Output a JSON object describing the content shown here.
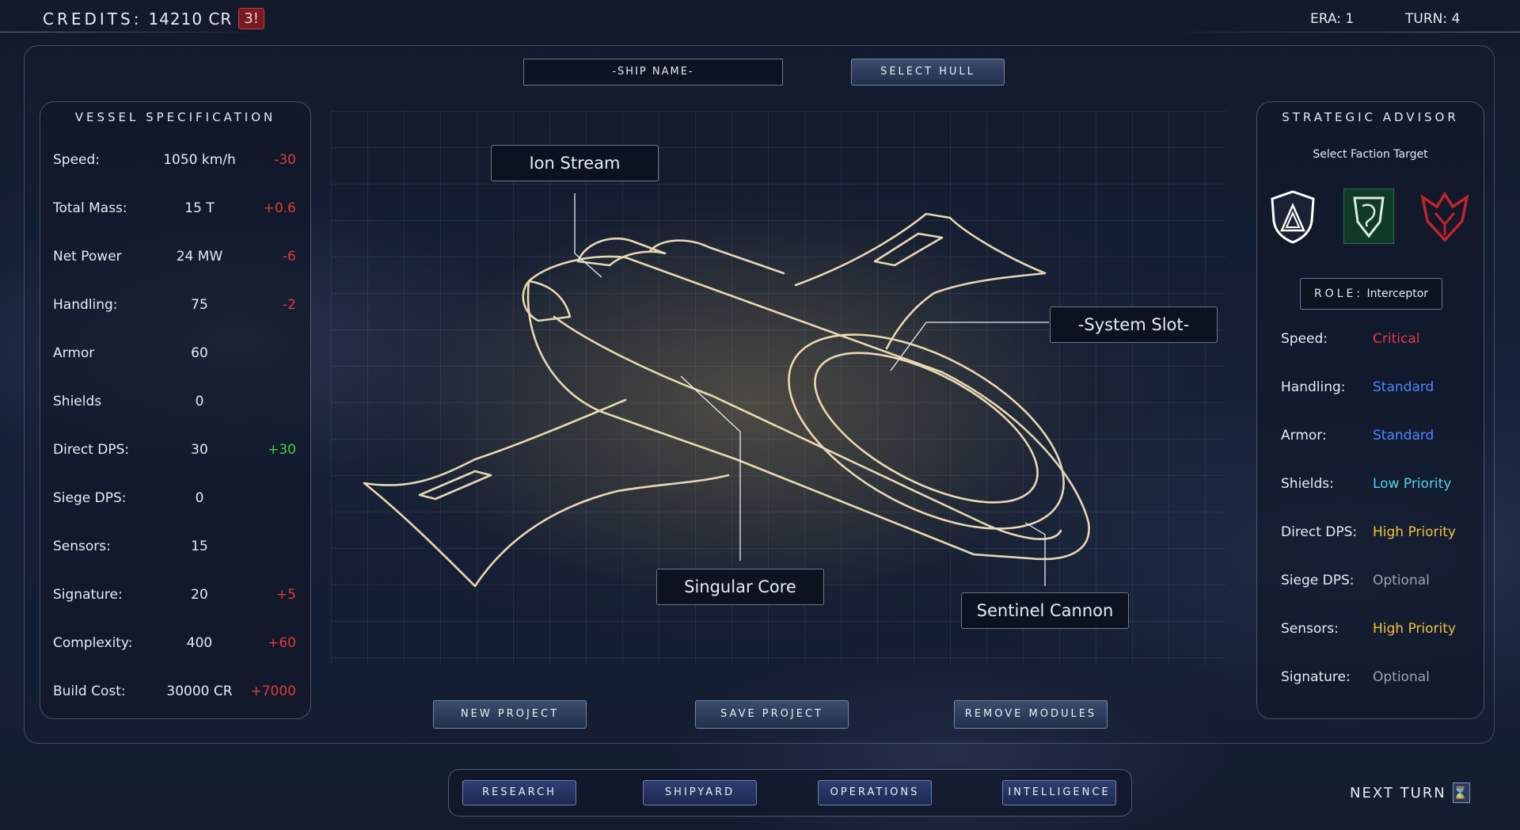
{
  "topbar": {
    "credits_label": "CREDITS:",
    "credits_value": "14210 CR",
    "credits_badge": "3!",
    "era": "ERA: 1",
    "turn": "TURN: 4"
  },
  "designer": {
    "ship_name_placeholder": "-SHIP NAME-",
    "select_hull": "SELECT HULL",
    "callouts": {
      "ion_stream": "Ion Stream",
      "system_slot": "-System Slot-",
      "singular_core": "Singular Core",
      "sentinel_cannon": "Sentinel Cannon"
    },
    "new_project": "NEW PROJECT",
    "save_project": "SAVE PROJECT",
    "remove_modules": "REMOVE MODULES"
  },
  "spec": {
    "title": "VESSEL SPECIFICATION",
    "rows": [
      {
        "label": "Speed:",
        "value": "1050 km/h",
        "delta": "-30",
        "sign": "neg"
      },
      {
        "label": "Total Mass:",
        "value": "15 T",
        "delta": "+0.6",
        "sign": "neg"
      },
      {
        "label": "Net Power",
        "value": "24 MW",
        "delta": "-6",
        "sign": "neg"
      },
      {
        "label": "Handling:",
        "value": "75",
        "delta": "-2",
        "sign": "neg"
      },
      {
        "label": "Armor",
        "value": "60",
        "delta": "",
        "sign": ""
      },
      {
        "label": "Shields",
        "value": "0",
        "delta": "",
        "sign": ""
      },
      {
        "label": "Direct DPS:",
        "value": "30",
        "delta": "+30",
        "sign": "pos"
      },
      {
        "label": "Siege DPS:",
        "value": "0",
        "delta": "",
        "sign": ""
      },
      {
        "label": "Sensors:",
        "value": "15",
        "delta": "",
        "sign": ""
      },
      {
        "label": "Signature:",
        "value": "20",
        "delta": "+5",
        "sign": "neg"
      },
      {
        "label": "Complexity:",
        "value": "400",
        "delta": "+60",
        "sign": "neg"
      },
      {
        "label": "Build Cost:",
        "value": "30000 CR",
        "delta": "+7000",
        "sign": "neg"
      }
    ]
  },
  "advisor": {
    "title": "STRATEGIC ADVISOR",
    "subtitle": "Select Faction Target",
    "factions": [
      "shield-faction-icon",
      "dragon-faction-icon",
      "eagle-faction-icon"
    ],
    "role_key": "ROLE:",
    "role_value": "Interceptor",
    "rows": [
      {
        "label": "Speed:",
        "value": "Critical",
        "color": "#e0374a"
      },
      {
        "label": "Handling:",
        "value": "Standard",
        "color": "#4a86ff"
      },
      {
        "label": "Armor:",
        "value": "Standard",
        "color": "#4a86ff"
      },
      {
        "label": "Shields:",
        "value": "Low Priority",
        "color": "#4fd4e6"
      },
      {
        "label": "Direct DPS:",
        "value": "High Priority",
        "color": "#f0c23a"
      },
      {
        "label": "Siege DPS:",
        "value": "Optional",
        "color": "#9aa3b3"
      },
      {
        "label": "Sensors:",
        "value": "High Priority",
        "color": "#f0c23a"
      },
      {
        "label": "Signature:",
        "value": "Optional",
        "color": "#9aa3b3"
      }
    ]
  },
  "nav": {
    "research": "RESEARCH",
    "shipyard": "SHIPYARD",
    "operations": "OPERATIONS",
    "intelligence": "INTELLIGENCE",
    "next_turn": "NEXT TURN"
  }
}
